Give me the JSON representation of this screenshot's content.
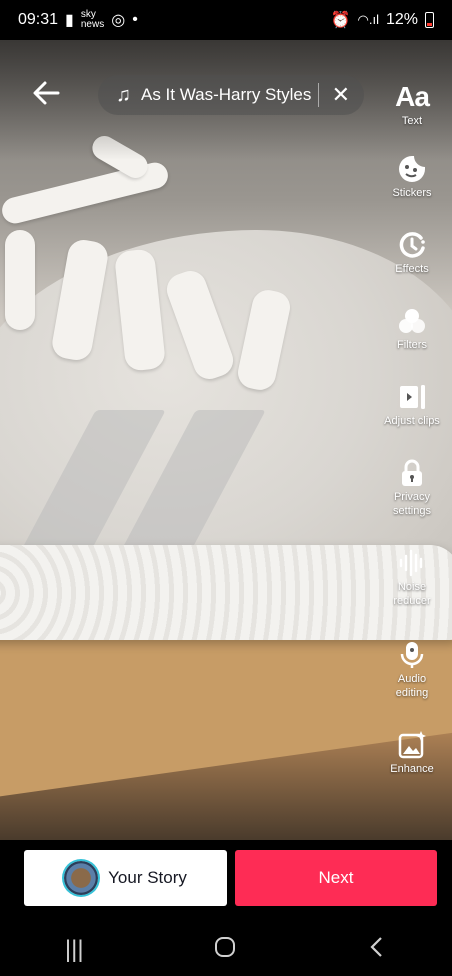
{
  "status_bar": {
    "time": "09:31",
    "notif_sky": "sky news",
    "battery": "12%"
  },
  "sound": {
    "title": "As It Was-Harry Styles"
  },
  "tools": [
    {
      "icon": "text-icon",
      "glyph": "Aa",
      "label": "Text"
    },
    {
      "icon": "stickers-icon",
      "label": "Stickers"
    },
    {
      "icon": "effects-icon",
      "label": "Effects"
    },
    {
      "icon": "filters-icon",
      "label": "Filters"
    },
    {
      "icon": "adjust-clips-icon",
      "label": "Adjust clips"
    },
    {
      "icon": "lock-icon",
      "label": "Privacy settings"
    },
    {
      "icon": "noise-reducer-icon",
      "label": "Noise reducer"
    },
    {
      "icon": "microphone-icon",
      "label": "Audio editing"
    },
    {
      "icon": "enhance-icon",
      "label": "Enhance"
    }
  ],
  "actions": {
    "your_story": "Your Story",
    "next": "Next"
  },
  "colors": {
    "next_button": "#fe2c55",
    "story_button": "#ffffff"
  }
}
